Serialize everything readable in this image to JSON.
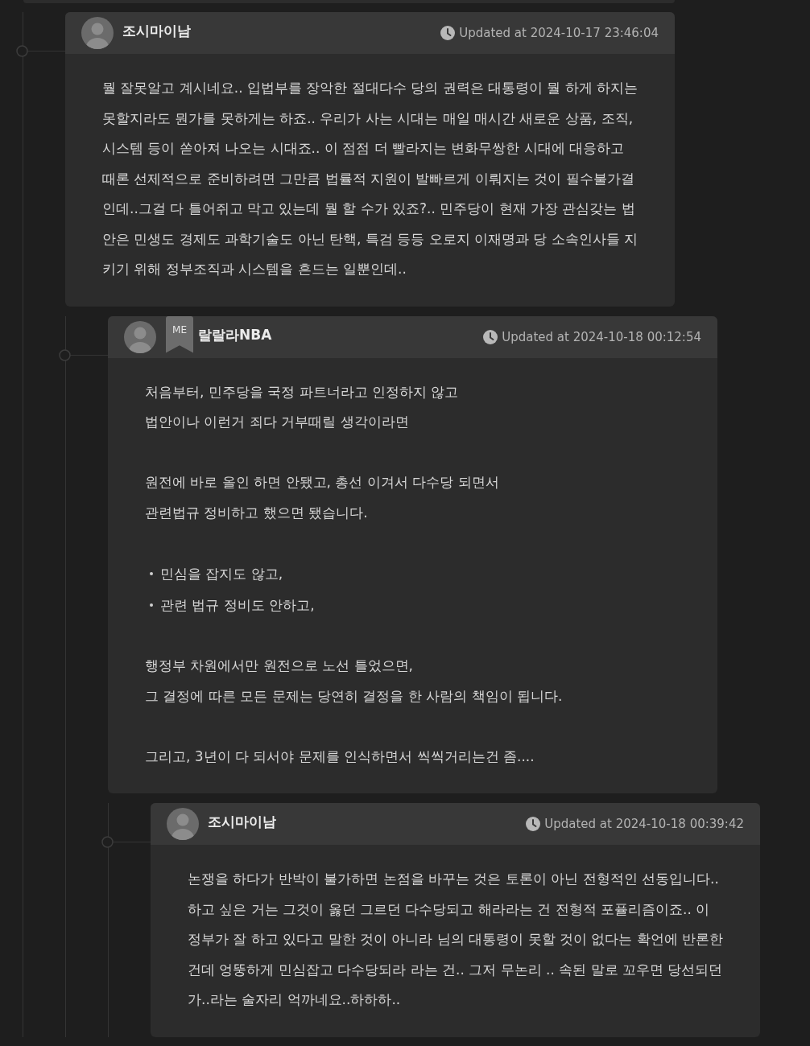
{
  "comments": [
    {
      "author": "조시마이남",
      "updated": "Updated at 2024-10-17 23:46:04",
      "body": [
        {
          "kind": "paragraph",
          "lines": [
            "뭘 잘못알고 계시네요.. 입법부를 장악한 절대다수 당의 권력은 대통령이 뭘 하게 하지는 못할지라도 뭔가를 못하게는 하죠.. 우리가 사는 시대는 매일 매시간 새로운 상품, 조직, 시스템 등이 쏟아져 나오는 시대죠.. 이 점점 더 빨라지는 변화무쌍한 시대에 대응하고 때론 선제적으로 준비하려면 그만큼 법률적 지원이 발빠르게 이뤄지는 것이 필수불가결인데..그걸 다 틀어쥐고 막고 있는데 뭘 할 수가 있죠?.. 민주당이 현재 가장 관심갖는 법안은 민생도 경제도 과학기술도 아닌 탄핵, 특검 등등 오로지 이재명과 당 소속인사들 지키기 위해 정부조직과 시스템을 흔드는 일뿐인데.."
          ]
        }
      ],
      "replies": [
        {
          "author": "랄랄라NBA",
          "badge": "ME",
          "updated": "Updated at 2024-10-18 00:12:54",
          "body": [
            {
              "kind": "paragraph",
              "lines": [
                "처음부터, 민주당을 국정 파트너라고 인정하지 않고",
                "법안이나 이런거 죄다 거부때릴 생각이라면"
              ]
            },
            {
              "kind": "paragraph",
              "lines": [
                "원전에 바로 올인 하면 안됐고, 총선 이겨서 다수당 되면서",
                "관련법규 정비하고 했으면 됐습니다."
              ]
            },
            {
              "kind": "bullets",
              "lines": [
                "민심을 잡지도 않고,",
                "관련 법규 정비도 안하고,"
              ]
            },
            {
              "kind": "paragraph",
              "lines": [
                "행정부 차원에서만 원전으로 노선 틀었으면,",
                "그 결정에 따른 모든 문제는 당연히 결정을 한 사람의 책임이 됩니다."
              ]
            },
            {
              "kind": "paragraph",
              "lines": [
                "그리고, 3년이 다 되서야 문제를 인식하면서 씩씩거리는건 좀...."
              ]
            }
          ],
          "replies": [
            {
              "author": "조시마이남",
              "updated": "Updated at 2024-10-18 00:39:42",
              "body": [
                {
                  "kind": "paragraph",
                  "lines": [
                    "논쟁을 하다가 반박이 불가하면 논점을 바꾸는 것은 토론이 아닌 전형적인 선동입니다.. 하고 싶은 거는 그것이 옳던 그르던 다수당되고 해라라는 건 전형적 포퓰리즘이죠.. 이 정부가 잘 하고 있다고 말한 것이 아니라 님의 대통령이 못할 것이 없다는 확언에 반론한 건데 엉뚱하게 민심잡고 다수당되라 라는 건.. 그저 무논리 .. 속된 말로 꼬우면 당선되던가..라는 술자리 억까네요..하하하.."
                  ]
                }
              ]
            }
          ]
        }
      ]
    }
  ]
}
